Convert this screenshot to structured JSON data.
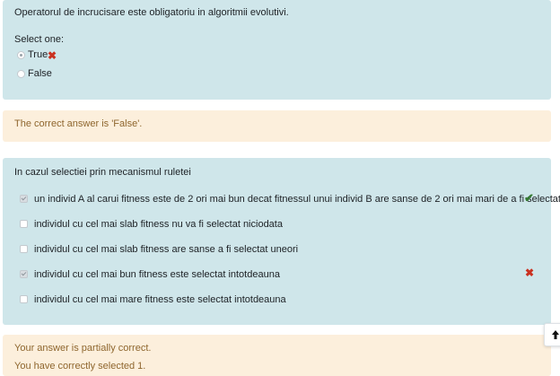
{
  "question1": {
    "text": "Operatorul de incrucisare este obligatoriu in algoritmii evolutivi.",
    "prompt": "Select one:",
    "options": [
      {
        "label": "True",
        "selected": true,
        "mark": "wrong"
      },
      {
        "label": "False",
        "selected": false,
        "mark": ""
      }
    ],
    "wrong_icon": "✖"
  },
  "feedback1": {
    "text": "The correct answer is 'False'."
  },
  "question2": {
    "text": "In cazul selectiei prin mecanismul ruletei",
    "options": [
      {
        "label": "un individ A al carui fitness este de 2 ori mai bun decat fitnessul unui individ B are sanse de 2 ori mai mari de a fi selectat",
        "checked": true,
        "mark": "correct"
      },
      {
        "label": "individul cu cel mai slab fitness nu va fi selectat niciodata",
        "checked": false,
        "mark": ""
      },
      {
        "label": "individul cu cel mai slab fitness are sanse a fi selectat uneori",
        "checked": false,
        "mark": ""
      },
      {
        "label": "individul cu cel mai bun fitness este selectat intotdeauna",
        "checked": true,
        "mark": "wrong"
      },
      {
        "label": "individul cu cel mai mare fitness este selectat intotdeauna",
        "checked": false,
        "mark": ""
      }
    ],
    "correct_icon": "✔",
    "wrong_icon": "✖"
  },
  "feedback2": {
    "line1": "Your answer is partially correct.",
    "line2": "You have correctly selected 1."
  },
  "colors": {
    "question_bg": "#cfe6ea",
    "feedback_bg": "#fcefdc",
    "feedback_text": "#8e662e",
    "correct": "#357a32",
    "wrong": "#ca3120"
  },
  "icons": {
    "back_to_top": "arrow-up-icon"
  }
}
